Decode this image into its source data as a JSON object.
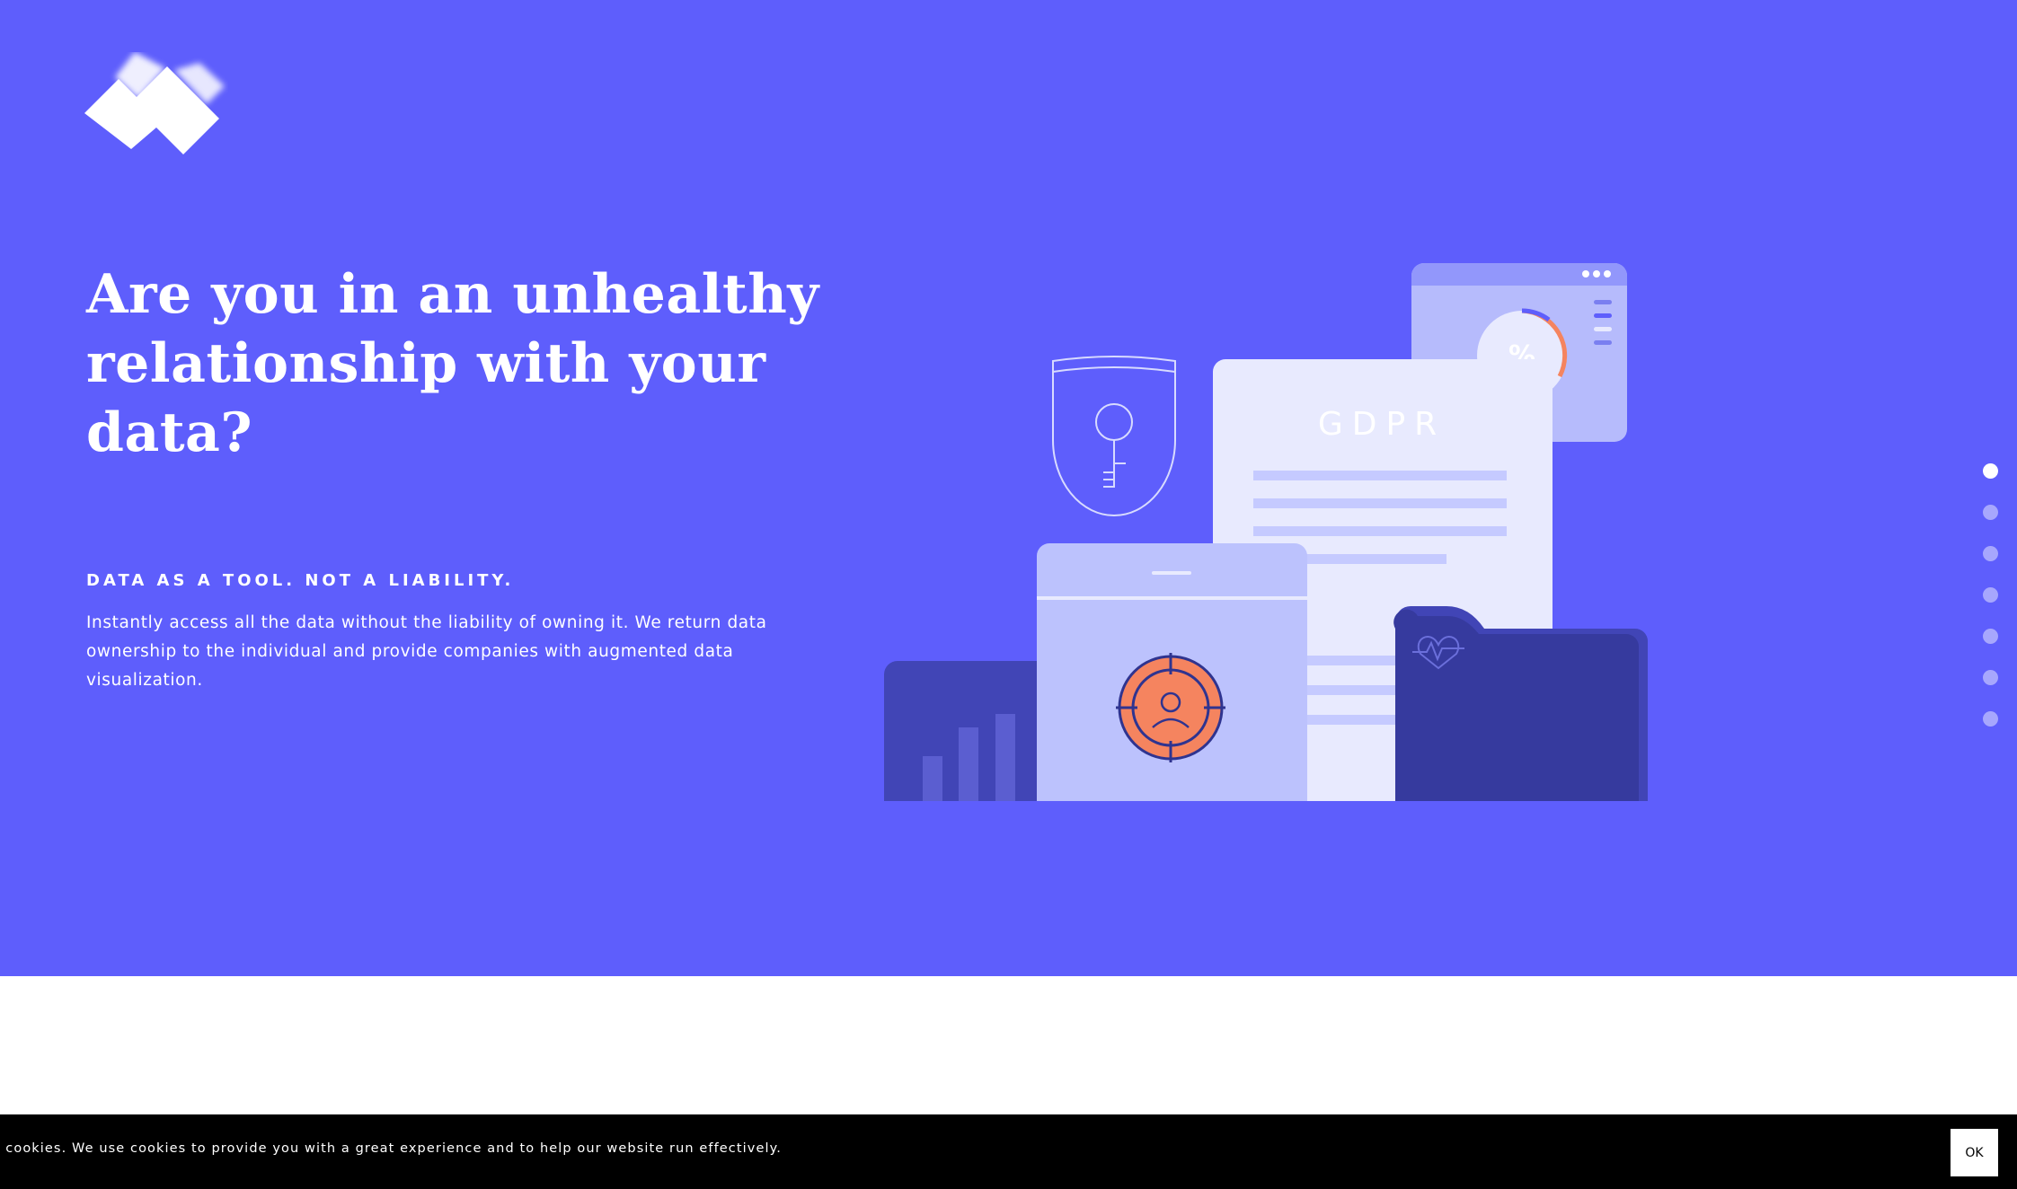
{
  "hero": {
    "background": "#5e5efc",
    "logo_icon": "brand-logo-icon",
    "headline": "Are you in an unhealthy relationship with your data?",
    "tagline": "DATA AS A TOOL. NOT A LIABILITY.",
    "description": "Instantly access all the data without the liability of owning it. We return data ownership to the individual and provide companies with augmented data visualization.",
    "illustration": {
      "document_title": "GDPR",
      "dashboard_symbol": "%"
    }
  },
  "section_nav": {
    "dot_count": 7,
    "active_index": 0
  },
  "cookie_banner": {
    "text": "se of cookies. We use cookies to provide you with a great experience and to help our website run effectively.",
    "ok_label": "OK"
  },
  "colors": {
    "accent": "#5e5efc",
    "orange": "#f5845f",
    "dark_indigo": "#3838a0",
    "light_lavender": "#bcc2fd"
  }
}
